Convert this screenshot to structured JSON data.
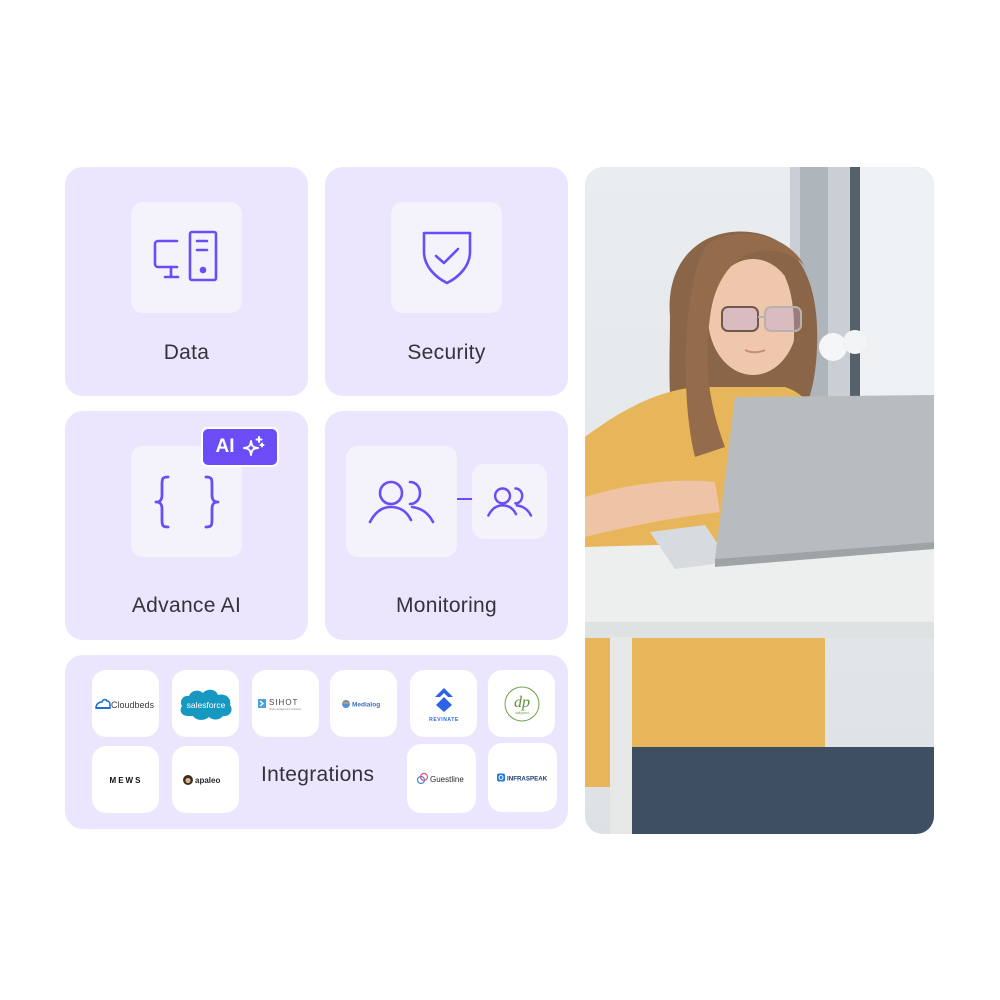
{
  "cards": {
    "data": {
      "label": "Data",
      "icon": "desktop-server-icon"
    },
    "security": {
      "label": "Security",
      "icon": "shield-check-icon"
    },
    "advance_ai": {
      "label": "Advance AI",
      "icon": "curly-braces-icon",
      "badge": {
        "label": "AI",
        "icon": "sparkle-icon"
      }
    },
    "monitoring": {
      "label": "Monitoring",
      "icon": "users-icon"
    }
  },
  "integrations": {
    "label": "Integrations",
    "logos": [
      {
        "name": "Cloudbeds",
        "text": "Cloudbeds"
      },
      {
        "name": "Salesforce",
        "text": "salesforce"
      },
      {
        "name": "SIHOT",
        "text": "SIHOT",
        "subtext": "hotel management software"
      },
      {
        "name": "Medialog",
        "text": "Medialog"
      },
      {
        "name": "Revinate",
        "text": "REVINATE"
      },
      {
        "name": "Dailypoint",
        "text": "dp",
        "subtext": "dailypoint"
      },
      {
        "name": "Mews",
        "text": "MEWS"
      },
      {
        "name": "Apaleo",
        "text": "apaleo"
      },
      {
        "name": "Guestline",
        "text": "Guestline"
      },
      {
        "name": "Infraspeak",
        "text": "INFRASPEAK"
      }
    ]
  },
  "photo": {
    "alt": "Woman with glasses working on a laptop at a white desk"
  },
  "colors": {
    "accent": "#6b4cf6",
    "card_bg": "#ebe6fd",
    "tile_bg": "#f4f3fb"
  }
}
